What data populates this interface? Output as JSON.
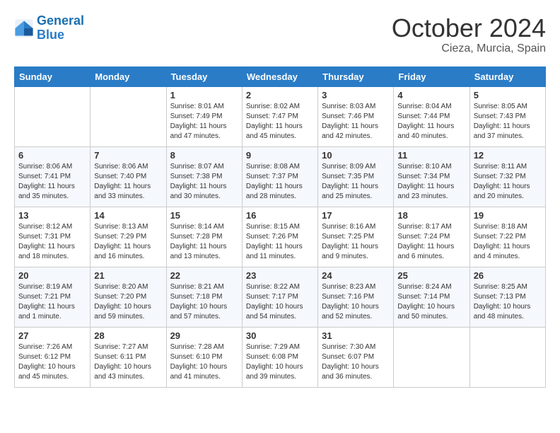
{
  "header": {
    "logo_general": "General",
    "logo_blue": "Blue",
    "month_title": "October 2024",
    "subtitle": "Cieza, Murcia, Spain"
  },
  "days_of_week": [
    "Sunday",
    "Monday",
    "Tuesday",
    "Wednesday",
    "Thursday",
    "Friday",
    "Saturday"
  ],
  "weeks": [
    [
      {
        "day": "",
        "info": ""
      },
      {
        "day": "",
        "info": ""
      },
      {
        "day": "1",
        "info": "Sunrise: 8:01 AM\nSunset: 7:49 PM\nDaylight: 11 hours and 47 minutes."
      },
      {
        "day": "2",
        "info": "Sunrise: 8:02 AM\nSunset: 7:47 PM\nDaylight: 11 hours and 45 minutes."
      },
      {
        "day": "3",
        "info": "Sunrise: 8:03 AM\nSunset: 7:46 PM\nDaylight: 11 hours and 42 minutes."
      },
      {
        "day": "4",
        "info": "Sunrise: 8:04 AM\nSunset: 7:44 PM\nDaylight: 11 hours and 40 minutes."
      },
      {
        "day": "5",
        "info": "Sunrise: 8:05 AM\nSunset: 7:43 PM\nDaylight: 11 hours and 37 minutes."
      }
    ],
    [
      {
        "day": "6",
        "info": "Sunrise: 8:06 AM\nSunset: 7:41 PM\nDaylight: 11 hours and 35 minutes."
      },
      {
        "day": "7",
        "info": "Sunrise: 8:06 AM\nSunset: 7:40 PM\nDaylight: 11 hours and 33 minutes."
      },
      {
        "day": "8",
        "info": "Sunrise: 8:07 AM\nSunset: 7:38 PM\nDaylight: 11 hours and 30 minutes."
      },
      {
        "day": "9",
        "info": "Sunrise: 8:08 AM\nSunset: 7:37 PM\nDaylight: 11 hours and 28 minutes."
      },
      {
        "day": "10",
        "info": "Sunrise: 8:09 AM\nSunset: 7:35 PM\nDaylight: 11 hours and 25 minutes."
      },
      {
        "day": "11",
        "info": "Sunrise: 8:10 AM\nSunset: 7:34 PM\nDaylight: 11 hours and 23 minutes."
      },
      {
        "day": "12",
        "info": "Sunrise: 8:11 AM\nSunset: 7:32 PM\nDaylight: 11 hours and 20 minutes."
      }
    ],
    [
      {
        "day": "13",
        "info": "Sunrise: 8:12 AM\nSunset: 7:31 PM\nDaylight: 11 hours and 18 minutes."
      },
      {
        "day": "14",
        "info": "Sunrise: 8:13 AM\nSunset: 7:29 PM\nDaylight: 11 hours and 16 minutes."
      },
      {
        "day": "15",
        "info": "Sunrise: 8:14 AM\nSunset: 7:28 PM\nDaylight: 11 hours and 13 minutes."
      },
      {
        "day": "16",
        "info": "Sunrise: 8:15 AM\nSunset: 7:26 PM\nDaylight: 11 hours and 11 minutes."
      },
      {
        "day": "17",
        "info": "Sunrise: 8:16 AM\nSunset: 7:25 PM\nDaylight: 11 hours and 9 minutes."
      },
      {
        "day": "18",
        "info": "Sunrise: 8:17 AM\nSunset: 7:24 PM\nDaylight: 11 hours and 6 minutes."
      },
      {
        "day": "19",
        "info": "Sunrise: 8:18 AM\nSunset: 7:22 PM\nDaylight: 11 hours and 4 minutes."
      }
    ],
    [
      {
        "day": "20",
        "info": "Sunrise: 8:19 AM\nSunset: 7:21 PM\nDaylight: 11 hours and 1 minute."
      },
      {
        "day": "21",
        "info": "Sunrise: 8:20 AM\nSunset: 7:20 PM\nDaylight: 10 hours and 59 minutes."
      },
      {
        "day": "22",
        "info": "Sunrise: 8:21 AM\nSunset: 7:18 PM\nDaylight: 10 hours and 57 minutes."
      },
      {
        "day": "23",
        "info": "Sunrise: 8:22 AM\nSunset: 7:17 PM\nDaylight: 10 hours and 54 minutes."
      },
      {
        "day": "24",
        "info": "Sunrise: 8:23 AM\nSunset: 7:16 PM\nDaylight: 10 hours and 52 minutes."
      },
      {
        "day": "25",
        "info": "Sunrise: 8:24 AM\nSunset: 7:14 PM\nDaylight: 10 hours and 50 minutes."
      },
      {
        "day": "26",
        "info": "Sunrise: 8:25 AM\nSunset: 7:13 PM\nDaylight: 10 hours and 48 minutes."
      }
    ],
    [
      {
        "day": "27",
        "info": "Sunrise: 7:26 AM\nSunset: 6:12 PM\nDaylight: 10 hours and 45 minutes."
      },
      {
        "day": "28",
        "info": "Sunrise: 7:27 AM\nSunset: 6:11 PM\nDaylight: 10 hours and 43 minutes."
      },
      {
        "day": "29",
        "info": "Sunrise: 7:28 AM\nSunset: 6:10 PM\nDaylight: 10 hours and 41 minutes."
      },
      {
        "day": "30",
        "info": "Sunrise: 7:29 AM\nSunset: 6:08 PM\nDaylight: 10 hours and 39 minutes."
      },
      {
        "day": "31",
        "info": "Sunrise: 7:30 AM\nSunset: 6:07 PM\nDaylight: 10 hours and 36 minutes."
      },
      {
        "day": "",
        "info": ""
      },
      {
        "day": "",
        "info": ""
      }
    ]
  ]
}
